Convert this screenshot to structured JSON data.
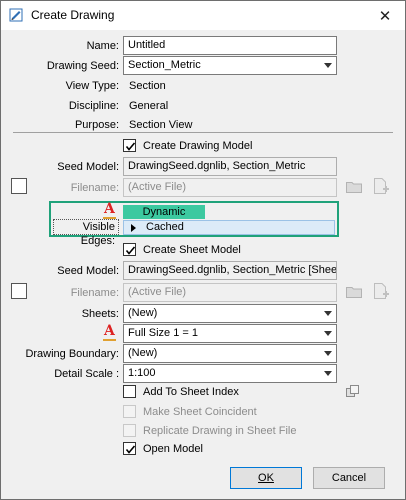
{
  "window": {
    "title": "Create Drawing",
    "close_glyph": "✕"
  },
  "fields": {
    "name_label": "Name:",
    "name_value": "Untitled",
    "drawing_seed_label": "Drawing Seed:",
    "drawing_seed_value": "Section_Metric",
    "view_type_label": "View Type:",
    "view_type_value": "Section",
    "discipline_label": "Discipline:",
    "discipline_value": "General",
    "purpose_label": "Purpose:",
    "purpose_value": "Section View"
  },
  "drawing_model": {
    "checkbox_label": "Create Drawing Model",
    "checked": true,
    "seed_model_label": "Seed Model:",
    "seed_model_value": "DrawingSeed.dgnlib, Section_Metric",
    "filename_label": "Filename:",
    "filename_placeholder": "(Active File)",
    "visible_edges_label": "Visible Edges:",
    "dropdown_options": [
      "Dynamic",
      "Cached"
    ],
    "highlighted_option": "Dynamic",
    "selected_option": "Cached"
  },
  "sheet_model": {
    "checkbox_label": "Create Sheet Model",
    "checked": true,
    "seed_model_label": "Seed Model:",
    "seed_model_value": "DrawingSeed.dgnlib, Section_Metric [Sheet]",
    "filename_label": "Filename:",
    "filename_placeholder": "(Active File)",
    "sheets_label": "Sheets:",
    "sheets_value": "(New)",
    "annotation_scale_value": "Full Size 1 = 1",
    "drawing_boundary_label": "Drawing Boundary:",
    "drawing_boundary_value": "(New)",
    "detail_scale_label": "Detail Scale :",
    "detail_scale_value": "1:100"
  },
  "options": {
    "add_to_sheet_index": "Add To Sheet Index",
    "make_sheet_coincident": "Make Sheet Coincident",
    "replicate_drawing": "Replicate Drawing in Sheet File",
    "open_model": "Open Model"
  },
  "buttons": {
    "ok": "OK",
    "cancel": "Cancel"
  },
  "colors": {
    "highlight_border": "#1fa27a",
    "dynamic_bg": "#3cc9a0",
    "ok_border": "#0078d7"
  }
}
